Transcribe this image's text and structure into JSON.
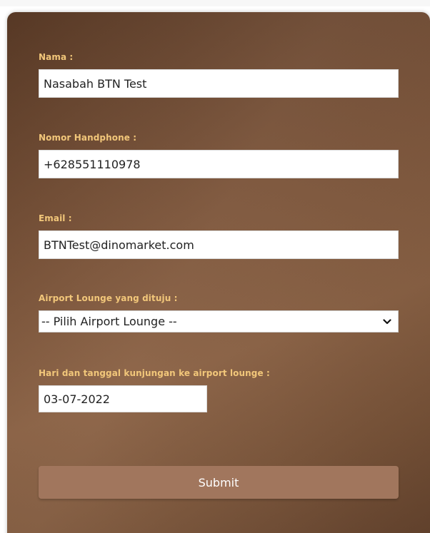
{
  "form": {
    "name": {
      "label": "Nama :",
      "value": "Nasabah BTN Test"
    },
    "phone": {
      "label": "Nomor Handphone :",
      "value": "+628551110978"
    },
    "email": {
      "label": "Email :",
      "value": "BTNTest@dinomarket.com"
    },
    "lounge": {
      "label": "Airport Lounge yang dituju :",
      "selected": "-- Pilih Airport Lounge --"
    },
    "visit_date": {
      "label": "Hari dan tanggal kunjungan ke airport lounge :",
      "value": "03-07-2022"
    },
    "submit_label": "Submit"
  },
  "colors": {
    "label_text": "#f2c77a",
    "card_gradient_dark": "#5e3d28",
    "card_gradient_light": "#8a6042",
    "submit_button": "#a1765d",
    "submit_text": "#ffffff"
  },
  "icons": {
    "select_arrow": "chevron-down-icon"
  }
}
